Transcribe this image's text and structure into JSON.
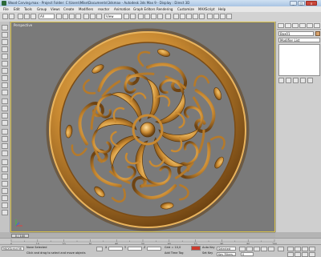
{
  "window": {
    "title": "Wood Carving.max  -  Project Folder: C:\\Users\\Mike\\Documents\\3dsmax  -  Autodesk 3ds Max 9  -  Display : Direct 3D",
    "minimize": "_",
    "maximize": "□",
    "close": "x"
  },
  "menu": [
    "File",
    "Edit",
    "Tools",
    "Group",
    "Views",
    "Create",
    "Modifiers",
    "reactor",
    "Animation",
    "Graph Editors",
    "Rendering",
    "Customize",
    "MAXScript",
    "Help"
  ],
  "toolbar": {
    "selection_filter": "All",
    "view_dropdown": "View"
  },
  "viewport": {
    "label": "Perspective",
    "material_color": "#c4893a"
  },
  "command_panel": {
    "object_name": "Box01",
    "modifier_list": "Modifier List"
  },
  "timeline": {
    "frame_slider": "0 / 100",
    "tick_labels": [
      "0",
      "10",
      "20",
      "30",
      "40",
      "50",
      "60",
      "70",
      "80",
      "90",
      "100"
    ]
  },
  "status": {
    "listener_label": "MAXScript Mi",
    "selection_status": "None Selected",
    "prompt": "Click and drag to select and move objects",
    "x_label": "X",
    "y_label": "Y",
    "z_label": "Z",
    "grid": "Grid = 10,0",
    "add_time_tag": "Add Time Tag",
    "auto_key": "Auto Key",
    "set_key": "Set Key",
    "key_mode": "Selected",
    "key_filters": "Key Filters...",
    "frame": "0"
  }
}
